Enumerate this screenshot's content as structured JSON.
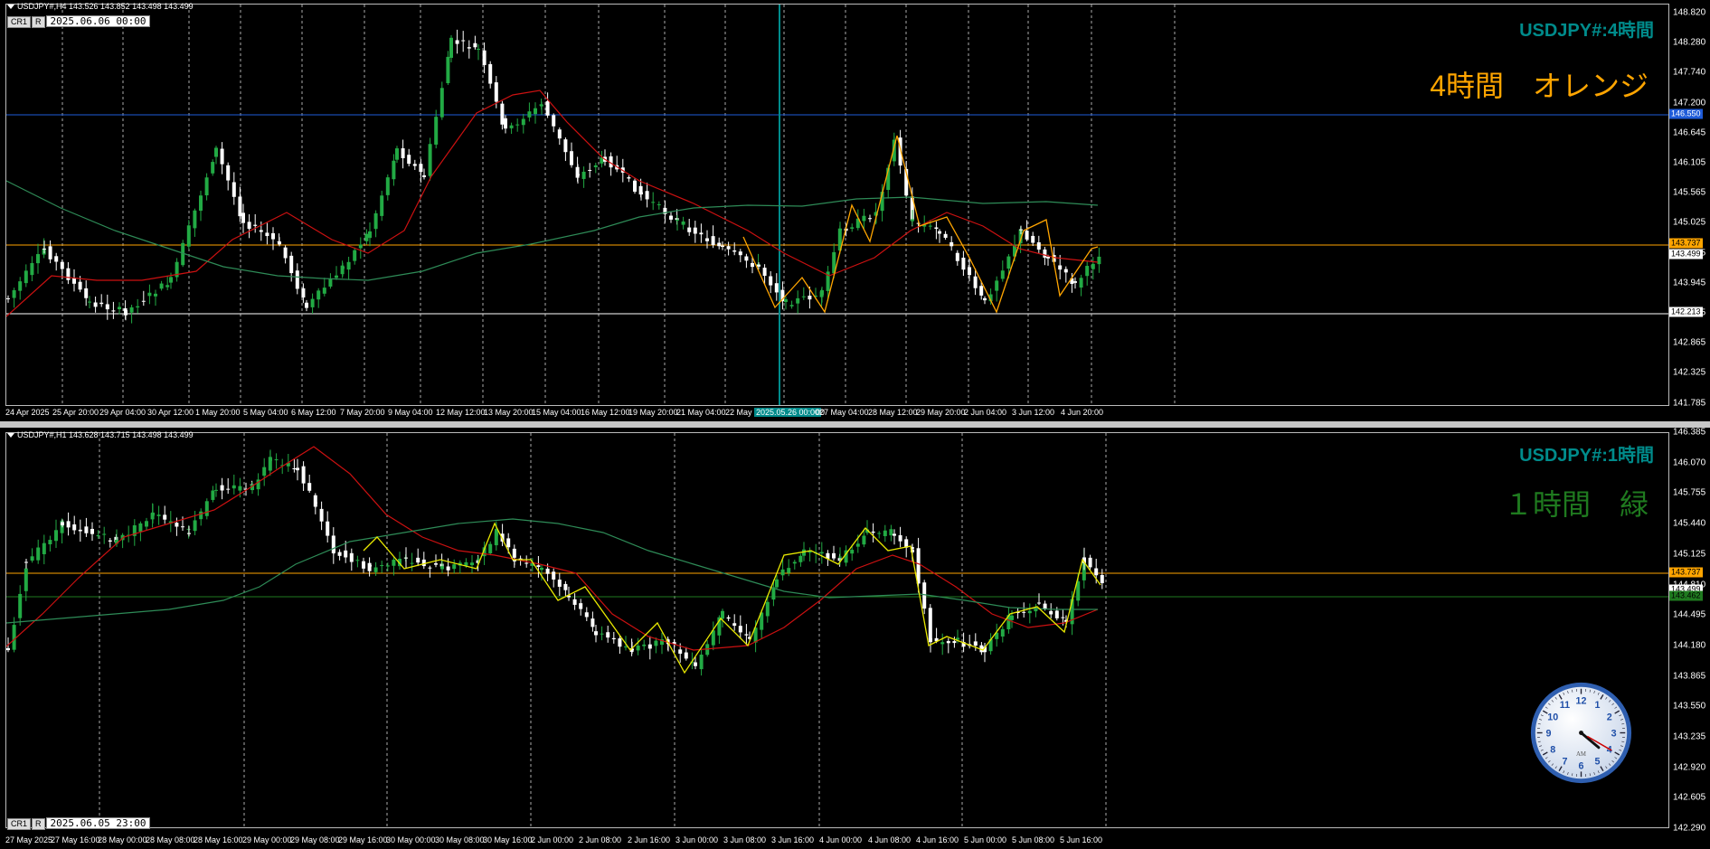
{
  "colors": {
    "up": "#22aa44",
    "down": "#ffffff",
    "ma_red": "#cc1111",
    "ma_green": "#2e8b57",
    "zigzag_orange": "#ffa500",
    "zigzag_yellow": "#e8e800",
    "hline_orange": "#ffa500",
    "hline_blue": "#1e5bd8",
    "hline_white": "#ffffff",
    "hline_green": "#1f7a1f",
    "vline": "#008b8b"
  },
  "pane_h4": {
    "title": "USDJPY#,H4  143.526 143.852 143.498 143.499",
    "cr": "CR1",
    "r": "R",
    "datetime": "2025.06.06 00:00",
    "symbol_label": "USDJPY#:4時間",
    "jp_label": "4時間　オレンジ",
    "jp_color": "#ffa500",
    "price_ticks": [
      "148.820",
      "148.280",
      "147.740",
      "147.200",
      "146.645",
      "146.105",
      "145.565",
      "145.025",
      "144.485",
      "143.945",
      "143.405",
      "142.865",
      "142.325",
      "141.785"
    ],
    "tags": [
      {
        "text": "146.550",
        "bg": "#1e5bd8",
        "fg": "#fff"
      },
      {
        "text": "143.737",
        "bg": "#ffa500",
        "fg": "#000"
      },
      {
        "text": "143.499",
        "bg": "#ffffff",
        "fg": "#000"
      },
      {
        "text": "142.213",
        "bg": "#ffffff",
        "fg": "#000"
      }
    ],
    "time_labels": [
      "24 Apr 2025",
      "25 Apr 20:00",
      "29 Apr 04:00",
      "30 Apr 12:00",
      "1 May 20:00",
      "5 May 04:00",
      "6 May 12:00",
      "7 May 20:00",
      "9 May 04:00",
      "12 May 12:00",
      "13 May 20:00",
      "15 May 04:00",
      "16 May 12:00",
      "19 May 20:00",
      "21 May 04:00",
      "22 May",
      "2025.05.26 00:00",
      "00",
      "27 May 04:00",
      "28 May 12:00",
      "29 May 20:00",
      "2 Jun 04:00",
      "3 Jun 12:00",
      "4 Jun 20:00"
    ]
  },
  "pane_h1": {
    "title": "USDJPY#,H1  143.628 143.715 143.498 143.499",
    "cr": "CR1",
    "r": "R",
    "datetime": "2025.06.05 23:00",
    "symbol_label": "USDJPY#:1時間",
    "jp_label": "１時間　緑",
    "jp_color": "#1f7a1f",
    "price_ticks": [
      "146.385",
      "146.070",
      "145.755",
      "145.440",
      "145.125",
      "144.810",
      "144.495",
      "144.180",
      "143.865",
      "143.550",
      "143.235",
      "142.920",
      "142.605",
      "142.290"
    ],
    "tags": [
      {
        "text": "143.737",
        "bg": "#ffa500",
        "fg": "#000"
      },
      {
        "text": "143.499",
        "bg": "#ffffff",
        "fg": "#000"
      },
      {
        "text": "143.462",
        "bg": "#1f7a1f",
        "fg": "#000"
      }
    ],
    "time_labels": [
      "27 May 2025",
      "27 May 16:00",
      "28 May 00:00",
      "28 May 08:00",
      "28 May 16:00",
      "29 May 00:00",
      "29 May 08:00",
      "29 May 16:00",
      "30 May 00:00",
      "30 May 08:00",
      "30 May 16:00",
      "2 Jun 00:00",
      "2 Jun 08:00",
      "2 Jun 16:00",
      "3 Jun 00:00",
      "3 Jun 08:00",
      "3 Jun 16:00",
      "4 Jun 00:00",
      "4 Jun 08:00",
      "4 Jun 16:00",
      "5 Jun 00:00",
      "5 Jun 08:00",
      "5 Jun 16:00"
    ]
  },
  "clock": {
    "numbers": [
      "12",
      "1",
      "2",
      "3",
      "4",
      "5",
      "6",
      "7",
      "8",
      "9",
      "10",
      "11"
    ],
    "ampm": "AM",
    "hour": 4,
    "minute": 20
  }
}
